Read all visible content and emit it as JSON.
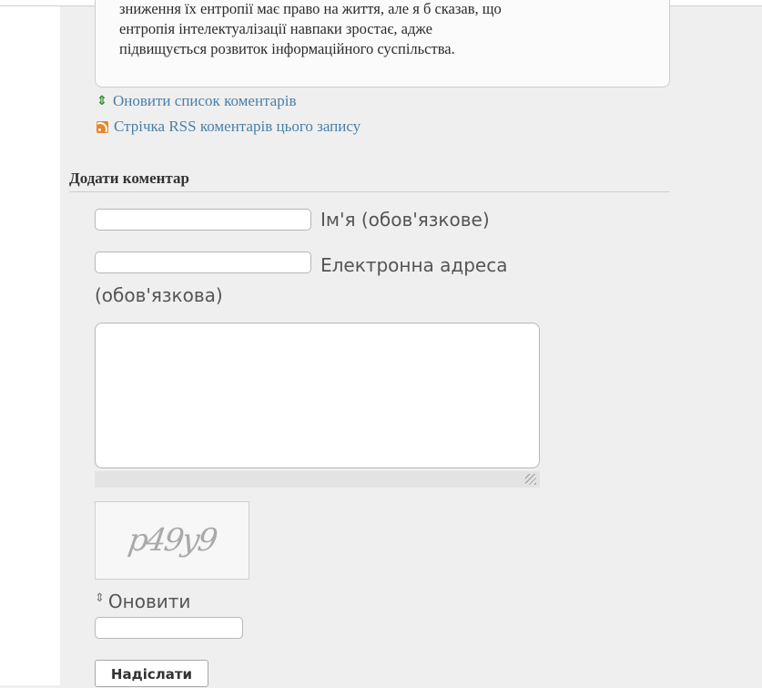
{
  "comment": {
    "partial_line": "зниження їх ентропії має право на життя, але я б сказав, що",
    "line2": "ентропія інтелектуалізації навпаки зростає, адже",
    "line3": "підвищується розвиток інформаційного суспільства."
  },
  "links": {
    "refresh_comments": "Оновити список коментарів",
    "rss_feed": "Стрічка RSS коментарів цього запису"
  },
  "form": {
    "title": "Додати коментар",
    "name_label": "Ім'я (обов'язкове)",
    "name_value": "",
    "email_label_1": "Електронна адреса",
    "email_label_2": "(обов'язкова)",
    "email_value": "",
    "comment_value": "",
    "captcha_text": "p49y9",
    "captcha_refresh": "Оновити",
    "captcha_value": "",
    "submit_label": "Надіслати"
  },
  "icons": {
    "refresh": "refresh-icon",
    "rss": "rss-icon",
    "resize": "resize-grip-icon"
  },
  "colors": {
    "link": "#4a7fa6",
    "refresh_icon": "#2e8b2e",
    "rss_icon": "#e8852a",
    "background": "#efefef"
  }
}
